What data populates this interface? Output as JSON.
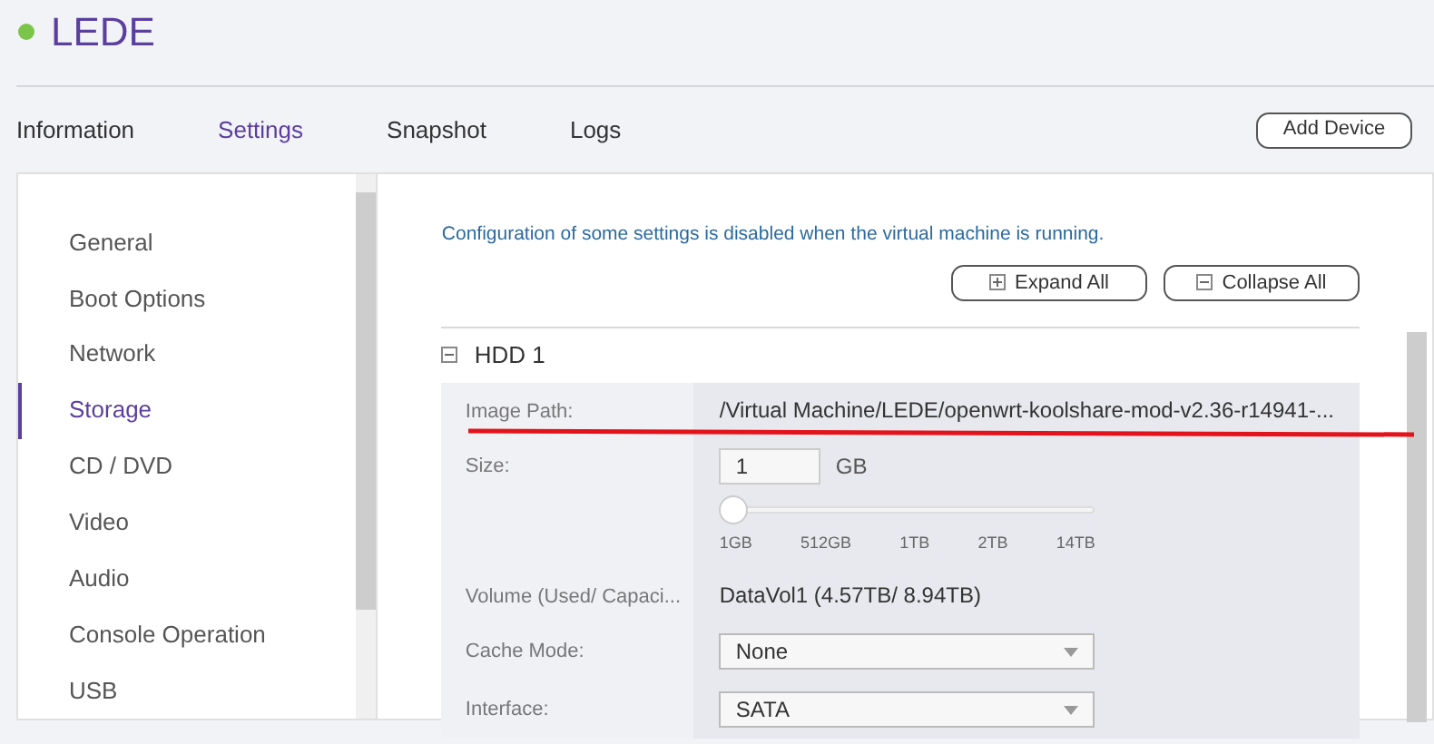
{
  "header": {
    "title": "LEDE",
    "running": true
  },
  "tabs": [
    {
      "label": "Information",
      "selected": false
    },
    {
      "label": "Settings",
      "selected": true
    },
    {
      "label": "Snapshot",
      "selected": false
    },
    {
      "label": "Logs",
      "selected": false
    }
  ],
  "add_device_button": "Add Device",
  "sidebar": {
    "items": [
      {
        "label": "General",
        "selected": false
      },
      {
        "label": "Boot Options",
        "selected": false
      },
      {
        "label": "Network",
        "selected": false
      },
      {
        "label": "Storage",
        "selected": true
      },
      {
        "label": "CD / DVD",
        "selected": false
      },
      {
        "label": "Video",
        "selected": false
      },
      {
        "label": "Audio",
        "selected": false
      },
      {
        "label": "Console Operation",
        "selected": false
      },
      {
        "label": "USB",
        "selected": false
      }
    ]
  },
  "notice": "Configuration of some settings is disabled when the virtual machine is running.",
  "buttons": [
    {
      "kind": "expand",
      "label": "Expand All"
    },
    {
      "kind": "collapse",
      "label": "Collapse All"
    }
  ],
  "section": {
    "title": "HDD 1",
    "expanded": true,
    "rows": [
      {
        "kind": "text",
        "label": "Image Path:",
        "value": "/Virtual Machine/LEDE/openwrt-koolshare-mod-v2.36-r14941-..."
      },
      {
        "kind": "size",
        "label": "Size:",
        "value": "1",
        "unit": "GB",
        "level": 0,
        "ticks": [
          "1GB",
          "512GB",
          "1TB",
          "2TB",
          "14TB"
        ]
      },
      {
        "kind": "text",
        "label": "Volume (Used/ Capaci...",
        "value": "DataVol1 (4.57TB/ 8.94TB)"
      },
      {
        "kind": "select",
        "label": "Cache Mode:",
        "value": "None"
      },
      {
        "kind": "select",
        "label": "Interface:",
        "value": "SATA"
      }
    ]
  }
}
